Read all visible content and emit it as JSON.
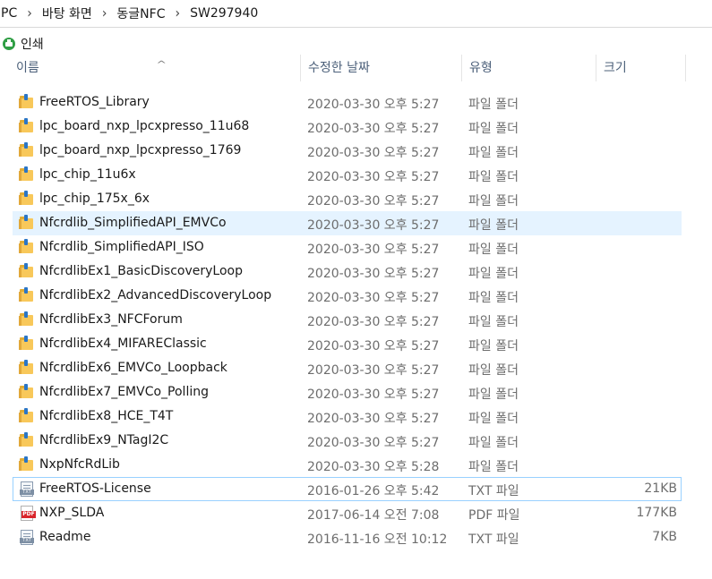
{
  "breadcrumb": [
    "PC",
    "바탕 화면",
    "동글NFC",
    "SW297940"
  ],
  "toolbar": {
    "print_label": "인쇄"
  },
  "columns": {
    "name": "이름",
    "date": "수정한 날짜",
    "type": "유형",
    "size": "크기"
  },
  "rows": [
    {
      "name": "FreeRTOS_Library",
      "date": "2020-03-30 오후 5:27",
      "type": "파일 폴더",
      "size": "",
      "kind": "folder"
    },
    {
      "name": "lpc_board_nxp_lpcxpresso_11u68",
      "date": "2020-03-30 오후 5:27",
      "type": "파일 폴더",
      "size": "",
      "kind": "folder"
    },
    {
      "name": "lpc_board_nxp_lpcxpresso_1769",
      "date": "2020-03-30 오후 5:27",
      "type": "파일 폴더",
      "size": "",
      "kind": "folder"
    },
    {
      "name": "lpc_chip_11u6x",
      "date": "2020-03-30 오후 5:27",
      "type": "파일 폴더",
      "size": "",
      "kind": "folder"
    },
    {
      "name": "lpc_chip_175x_6x",
      "date": "2020-03-30 오후 5:27",
      "type": "파일 폴더",
      "size": "",
      "kind": "folder"
    },
    {
      "name": "Nfcrdlib_SimplifiedAPI_EMVCo",
      "date": "2020-03-30 오후 5:27",
      "type": "파일 폴더",
      "size": "",
      "kind": "folder"
    },
    {
      "name": "Nfcrdlib_SimplifiedAPI_ISO",
      "date": "2020-03-30 오후 5:27",
      "type": "파일 폴더",
      "size": "",
      "kind": "folder"
    },
    {
      "name": "NfcrdlibEx1_BasicDiscoveryLoop",
      "date": "2020-03-30 오후 5:27",
      "type": "파일 폴더",
      "size": "",
      "kind": "folder"
    },
    {
      "name": "NfcrdlibEx2_AdvancedDiscoveryLoop",
      "date": "2020-03-30 오후 5:27",
      "type": "파일 폴더",
      "size": "",
      "kind": "folder"
    },
    {
      "name": "NfcrdlibEx3_NFCForum",
      "date": "2020-03-30 오후 5:27",
      "type": "파일 폴더",
      "size": "",
      "kind": "folder"
    },
    {
      "name": "NfcrdlibEx4_MIFAREClassic",
      "date": "2020-03-30 오후 5:27",
      "type": "파일 폴더",
      "size": "",
      "kind": "folder"
    },
    {
      "name": "NfcrdlibEx6_EMVCo_Loopback",
      "date": "2020-03-30 오후 5:27",
      "type": "파일 폴더",
      "size": "",
      "kind": "folder"
    },
    {
      "name": "NfcrdlibEx7_EMVCo_Polling",
      "date": "2020-03-30 오후 5:27",
      "type": "파일 폴더",
      "size": "",
      "kind": "folder"
    },
    {
      "name": "NfcrdlibEx8_HCE_T4T",
      "date": "2020-03-30 오후 5:27",
      "type": "파일 폴더",
      "size": "",
      "kind": "folder"
    },
    {
      "name": "NfcrdlibEx9_NTagI2C",
      "date": "2020-03-30 오후 5:27",
      "type": "파일 폴더",
      "size": "",
      "kind": "folder"
    },
    {
      "name": "NxpNfcRdLib",
      "date": "2020-03-30 오후 5:28",
      "type": "파일 폴더",
      "size": "",
      "kind": "folder"
    },
    {
      "name": "FreeRTOS-License",
      "date": "2016-01-26 오후 5:42",
      "type": "TXT 파일",
      "size": "21KB",
      "kind": "txt"
    },
    {
      "name": "NXP_SLDA",
      "date": "2017-06-14 오전 7:08",
      "type": "PDF 파일",
      "size": "177KB",
      "kind": "pdf"
    },
    {
      "name": "Readme",
      "date": "2016-11-16 오전 10:12",
      "type": "TXT 파일",
      "size": "7KB",
      "kind": "txt"
    }
  ],
  "state": {
    "hover_row": 5,
    "focus_row": 16
  },
  "icons": {
    "folder": "folder-icon",
    "txt": "text-file-icon",
    "pdf": "pdf-file-icon",
    "print": "print-icon"
  },
  "colors": {
    "hover_bg": "#e5f3ff",
    "focus_border": "#99d1ff",
    "header_text": "#4c607a"
  }
}
